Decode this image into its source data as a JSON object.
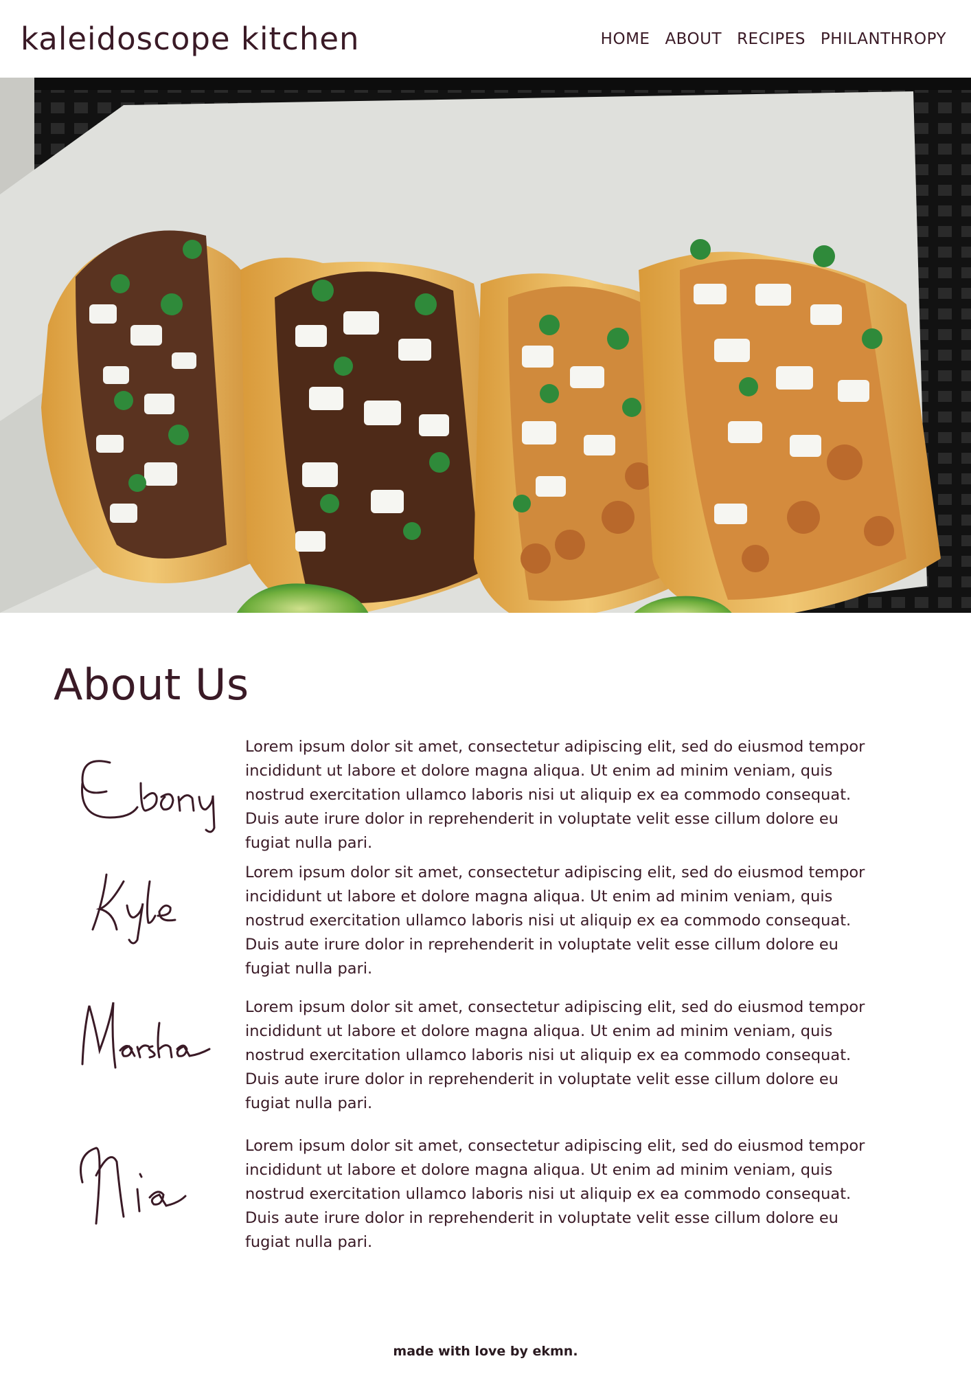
{
  "header": {
    "brand": "kaleidoscope kitchen",
    "nav": [
      "HOME",
      "ABOUT",
      "RECIPES",
      "PHILANTHROPY"
    ]
  },
  "about": {
    "title": "About Us",
    "members": [
      {
        "name": "Ebony",
        "bio": "Lorem ipsum dolor sit amet, consectetur adipiscing elit, sed do eiusmod tempor incididunt ut labore et dolore magna aliqua. Ut enim ad minim veniam, quis nostrud exercitation ullamco laboris nisi ut aliquip ex ea commodo consequat. Duis aute irure dolor in reprehenderit in voluptate velit esse cillum dolore eu fugiat nulla pari."
      },
      {
        "name": "Kyle",
        "bio": "Lorem ipsum dolor sit amet, consectetur adipiscing elit, sed do eiusmod tempor incididunt ut labore et dolore magna aliqua. Ut enim ad minim veniam, quis nostrud exercitation ullamco laboris nisi ut aliquip ex ea commodo consequat. Duis aute irure dolor in reprehenderit in voluptate velit esse cillum dolore eu fugiat nulla pari."
      },
      {
        "name": "Marsha",
        "bio": "Lorem ipsum dolor sit amet, consectetur adipiscing elit, sed do eiusmod tempor incididunt ut labore et dolore magna aliqua. Ut enim ad minim veniam, quis nostrud exercitation ullamco laboris nisi ut aliquip ex ea commodo consequat. Duis aute irure dolor in reprehenderit in voluptate velit esse cillum dolore eu fugiat nulla pari."
      },
      {
        "name": "Nia",
        "bio": "Lorem ipsum dolor sit amet, consectetur adipiscing elit, sed do eiusmod tempor incididunt ut labore et dolore magna aliqua. Ut enim ad minim veniam, quis nostrud exercitation ullamco laboris nisi ut aliquip ex ea commodo consequat. Duis aute irure dolor in reprehenderit in voluptate velit esse cillum dolore eu fugiat nulla pari."
      }
    ]
  },
  "footer": {
    "text": "made with love by ekmn."
  },
  "colors": {
    "text": "#3a1a26",
    "background": "#ffffff"
  }
}
